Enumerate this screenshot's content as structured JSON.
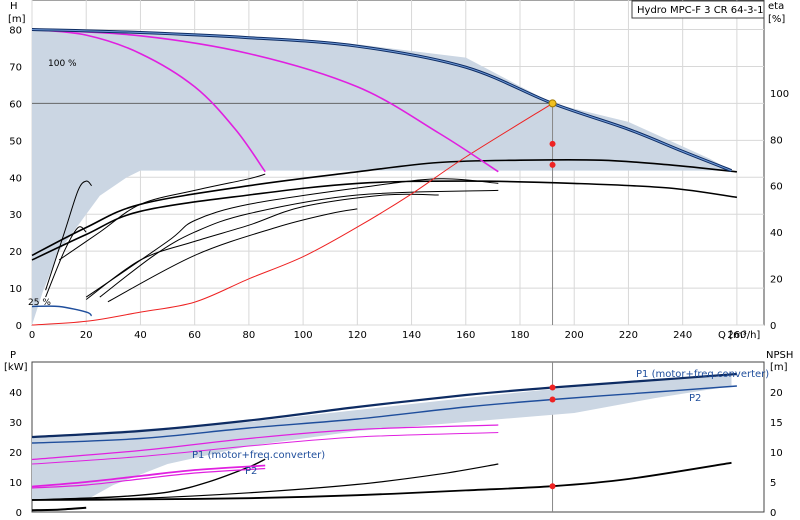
{
  "chart_data": [
    {
      "id": "top",
      "type": "line",
      "title": "Hydro MPC-F 3 CR 64-3-1",
      "xlabel": "Q [m³/h]",
      "ylabel_left_name": "H",
      "ylabel_left_unit": "[m]",
      "ylabel_right_name": "eta",
      "ylabel_right_unit": "[%]",
      "xlim": [
        0,
        270
      ],
      "ylim_left": [
        0,
        88
      ],
      "ylim_right_range": [
        0,
        140
      ],
      "xticks": [
        0,
        20,
        40,
        60,
        80,
        100,
        120,
        140,
        160,
        180,
        200,
        220,
        240,
        260
      ],
      "yticks_left": [
        0,
        10,
        20,
        30,
        40,
        50,
        60,
        70,
        80
      ],
      "yticks_right": [
        0,
        20,
        40,
        60,
        80,
        100
      ],
      "grid": true,
      "annotations": {
        "top_left": "100 %",
        "bottom_left": "25 %"
      },
      "operating_point": {
        "q": 192,
        "h": 60
      },
      "colors": {
        "max_curve": "#1f4e9c",
        "speed_curves": "#e020e0",
        "system_curve": "#ee2222",
        "eta_curves": "#000000",
        "region": "#cbd6e3",
        "marker": "#ee2222",
        "op_marker": "#f0c020"
      },
      "region_upper": [
        [
          0,
          80
        ],
        [
          40,
          79.2
        ],
        [
          80,
          78
        ],
        [
          120,
          76
        ],
        [
          160,
          72.4
        ],
        [
          192,
          60
        ],
        [
          220,
          55
        ],
        [
          250,
          45
        ],
        [
          258,
          41.8
        ]
      ],
      "region_lower": [
        [
          258,
          41.8
        ],
        [
          40,
          41.8
        ],
        [
          35,
          40
        ],
        [
          25,
          35
        ],
        [
          20,
          30
        ],
        [
          15,
          25
        ],
        [
          10,
          20
        ],
        [
          4,
          9
        ],
        [
          0,
          0
        ]
      ],
      "max_curve": [
        [
          0,
          80
        ],
        [
          40,
          79.2
        ],
        [
          80,
          77.8
        ],
        [
          120,
          75.5
        ],
        [
          160,
          69.8
        ],
        [
          192,
          60
        ],
        [
          220,
          53
        ],
        [
          240,
          47
        ],
        [
          258,
          41.8
        ]
      ],
      "speed_curves": [
        [
          [
            0,
            80
          ],
          [
            20,
            78.5
          ],
          [
            40,
            73.5
          ],
          [
            60,
            64.5
          ],
          [
            75,
            53
          ],
          [
            86,
            41.5
          ]
        ],
        [
          [
            0,
            80
          ],
          [
            40,
            78.3
          ],
          [
            80,
            73.5
          ],
          [
            120,
            64.5
          ],
          [
            150,
            52
          ],
          [
            172,
            41.5
          ]
        ]
      ],
      "system_curve": [
        [
          0,
          0
        ],
        [
          20,
          1
        ],
        [
          40,
          3.5
        ],
        [
          60,
          6.2
        ],
        [
          80,
          12.5
        ],
        [
          100,
          18.5
        ],
        [
          120,
          26.5
        ],
        [
          140,
          35.5
        ],
        [
          160,
          45.5
        ],
        [
          192,
          60
        ]
      ],
      "eta_main": [
        [
          [
            0,
            30
          ],
          [
            20,
            42
          ],
          [
            40,
            52
          ],
          [
            80,
            60
          ],
          [
            120,
            66
          ],
          [
            150,
            70
          ],
          [
            180,
            71
          ],
          [
            210,
            71
          ],
          [
            235,
            69
          ],
          [
            260,
            66
          ]
        ],
        [
          [
            0,
            28
          ],
          [
            20,
            39
          ],
          [
            40,
            49
          ],
          [
            80,
            56
          ],
          [
            120,
            61
          ],
          [
            160,
            62
          ],
          [
            200,
            61
          ],
          [
            235,
            59
          ],
          [
            260,
            55
          ]
        ]
      ],
      "eta_small": [
        [
          [
            10,
            28
          ],
          [
            25,
            40
          ],
          [
            40,
            52
          ],
          [
            60,
            58
          ],
          [
            80,
            63
          ],
          [
            86,
            65
          ]
        ],
        [
          [
            20,
            12
          ],
          [
            50,
            36
          ],
          [
            60,
            45
          ],
          [
            80,
            52
          ],
          [
            120,
            59
          ],
          [
            150,
            63
          ],
          [
            172,
            61
          ]
        ],
        [
          [
            25,
            12
          ],
          [
            45,
            30
          ],
          [
            60,
            40
          ],
          [
            80,
            48
          ],
          [
            120,
            56
          ],
          [
            172,
            58
          ]
        ],
        [
          [
            20,
            11
          ],
          [
            40,
            28
          ],
          [
            60,
            36
          ],
          [
            80,
            43
          ],
          [
            100,
            51
          ],
          [
            130,
            56
          ],
          [
            150,
            56
          ]
        ],
        [
          [
            28,
            10
          ],
          [
            60,
            30
          ],
          [
            90,
            42
          ],
          [
            110,
            48
          ],
          [
            120,
            50
          ]
        ],
        [
          [
            5,
            15
          ],
          [
            12,
            40
          ],
          [
            17,
            58
          ],
          [
            20,
            62
          ],
          [
            22,
            60
          ]
        ],
        [
          [
            5,
            12
          ],
          [
            12,
            32
          ],
          [
            17,
            42
          ],
          [
            20,
            40
          ]
        ]
      ],
      "eta_points": [
        {
          "q": 192,
          "eta": 78
        },
        {
          "q": 192,
          "eta": 69
        }
      ]
    },
    {
      "id": "bottom",
      "type": "line",
      "xlim": [
        0,
        270
      ],
      "ylabel_left_name": "P",
      "ylabel_left_unit": "[kW]",
      "ylabel_right_name": "NPSH",
      "ylabel_right_unit": "[m]",
      "ylim_left": [
        0,
        50
      ],
      "ylim_right_range": [
        0,
        25
      ],
      "yticks_left": [
        0,
        10,
        20,
        30,
        40
      ],
      "yticks_right": [
        0,
        5,
        10,
        15,
        20
      ],
      "grid": false,
      "annotations": {
        "p1_top": "P1 (motor+freq.converter)",
        "p2_top": "P2",
        "p1_mid": "P1 (motor+freq.converter)",
        "p2_mid": "P2"
      },
      "p1_max": [
        [
          0,
          25
        ],
        [
          40,
          27
        ],
        [
          80,
          30.5
        ],
        [
          120,
          35
        ],
        [
          160,
          39
        ],
        [
          192,
          41.5
        ],
        [
          230,
          44
        ],
        [
          260,
          46
        ]
      ],
      "p2_max": [
        [
          0,
          23
        ],
        [
          40,
          24.5
        ],
        [
          80,
          28
        ],
        [
          120,
          31
        ],
        [
          160,
          35
        ],
        [
          192,
          37.5
        ],
        [
          230,
          40
        ],
        [
          260,
          42
        ]
      ],
      "p1_mid": [
        [
          0,
          17.5
        ],
        [
          40,
          20.5
        ],
        [
          80,
          24.5
        ],
        [
          120,
          27.5
        ],
        [
          172,
          29
        ]
      ],
      "p2_mid": [
        [
          0,
          16
        ],
        [
          40,
          18.5
        ],
        [
          80,
          22
        ],
        [
          120,
          25
        ],
        [
          172,
          26.5
        ]
      ],
      "p1_low": [
        [
          0,
          8.5
        ],
        [
          20,
          10
        ],
        [
          40,
          12
        ],
        [
          60,
          14
        ],
        [
          86,
          15.5
        ]
      ],
      "p2_low": [
        [
          0,
          8
        ],
        [
          20,
          9
        ],
        [
          40,
          11
        ],
        [
          60,
          13
        ],
        [
          86,
          14.5
        ]
      ],
      "power_region": [
        [
          0,
          25
        ],
        [
          80,
          30
        ],
        [
          120,
          34
        ],
        [
          160,
          38
        ],
        [
          192,
          41
        ],
        [
          230,
          44
        ],
        [
          258,
          46
        ],
        [
          258,
          42
        ],
        [
          230,
          38
        ],
        [
          200,
          33
        ],
        [
          160,
          30
        ],
        [
          120,
          27
        ],
        [
          80,
          22
        ],
        [
          50,
          16
        ],
        [
          30,
          9
        ],
        [
          20,
          4
        ],
        [
          0,
          4
        ]
      ],
      "npsh_main": [
        [
          0,
          2
        ],
        [
          40,
          2.1
        ],
        [
          80,
          2.3
        ],
        [
          120,
          2.8
        ],
        [
          160,
          3.6
        ],
        [
          192,
          4.3
        ],
        [
          220,
          5.5
        ],
        [
          258,
          8.2
        ]
      ],
      "npsh_mid": [
        [
          0,
          2
        ],
        [
          40,
          2.3
        ],
        [
          80,
          3.2
        ],
        [
          120,
          4.6
        ],
        [
          150,
          6.3
        ],
        [
          172,
          8
        ]
      ],
      "npsh_low": [
        [
          0,
          2
        ],
        [
          30,
          2.5
        ],
        [
          50,
          3.3
        ],
        [
          65,
          5
        ],
        [
          80,
          7.5
        ],
        [
          86,
          8.8
        ]
      ],
      "npsh_small": [
        [
          0,
          0.3
        ],
        [
          10,
          0.4
        ],
        [
          20,
          0.7
        ]
      ],
      "power_points": [
        {
          "q": 192,
          "p": 41.5
        },
        {
          "q": 192,
          "p": 37.5
        }
      ],
      "npsh_points": [
        {
          "q": 192,
          "npsh": 4.3
        }
      ]
    }
  ],
  "operating_line": {
    "q": 192
  }
}
